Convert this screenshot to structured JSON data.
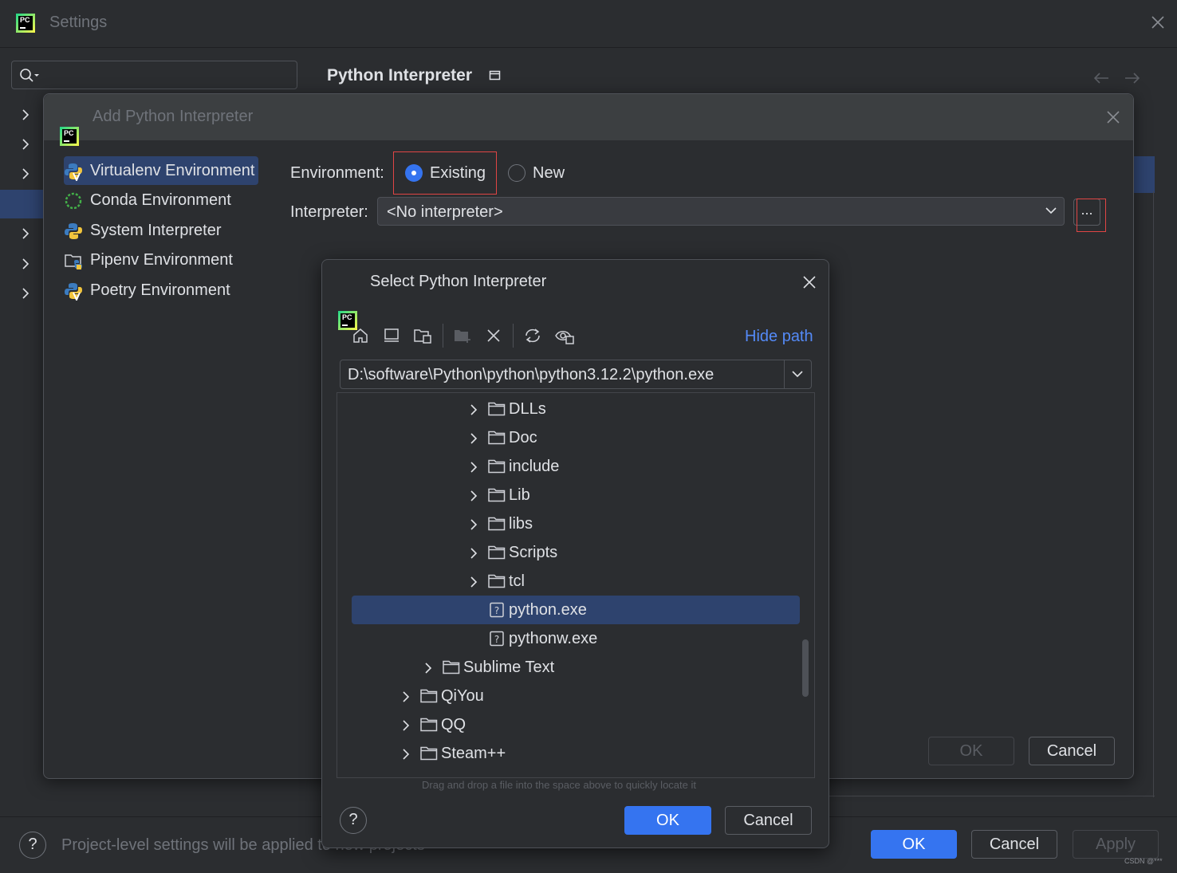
{
  "settings": {
    "title": "Settings",
    "heading": "Python Interpreter",
    "footer_note": "Project-level settings will be applied to new projects",
    "buttons": {
      "ok": "OK",
      "cancel": "Cancel",
      "apply": "Apply"
    },
    "help": "?"
  },
  "add_dialog": {
    "title": "Add Python Interpreter",
    "environments": [
      {
        "label": "Virtualenv Environment",
        "icon": "python-virtualenv-icon",
        "selected": true
      },
      {
        "label": "Conda Environment",
        "icon": "conda-icon",
        "selected": false
      },
      {
        "label": "System Interpreter",
        "icon": "python-icon",
        "selected": false
      },
      {
        "label": "Pipenv Environment",
        "icon": "pipenv-folder-icon",
        "selected": false
      },
      {
        "label": "Poetry Environment",
        "icon": "poetry-icon",
        "selected": false
      }
    ],
    "environment_label": "Environment:",
    "radio_existing": "Existing",
    "radio_new": "New",
    "interpreter_label": "Interpreter:",
    "interpreter_value": "<No interpreter>",
    "browse_label": "...",
    "buttons": {
      "ok": "OK",
      "cancel": "Cancel"
    }
  },
  "select_dialog": {
    "title": "Select Python Interpreter",
    "hide_path": "Hide path",
    "path": "D:\\software\\Python\\python\\python3.12.2\\python.exe",
    "toolbar_icons": [
      "home-icon",
      "desktop-icon",
      "project-folder-icon",
      "new-folder-icon",
      "delete-icon",
      "refresh-icon",
      "show-hidden-icon"
    ],
    "tree": [
      {
        "name": "DLLs",
        "type": "folder",
        "level": 3,
        "expandable": true,
        "selected": false
      },
      {
        "name": "Doc",
        "type": "folder",
        "level": 3,
        "expandable": true,
        "selected": false
      },
      {
        "name": "include",
        "type": "folder",
        "level": 3,
        "expandable": true,
        "selected": false
      },
      {
        "name": "Lib",
        "type": "folder",
        "level": 3,
        "expandable": true,
        "selected": false
      },
      {
        "name": "libs",
        "type": "folder",
        "level": 3,
        "expandable": true,
        "selected": false
      },
      {
        "name": "Scripts",
        "type": "folder",
        "level": 3,
        "expandable": true,
        "selected": false
      },
      {
        "name": "tcl",
        "type": "folder",
        "level": 3,
        "expandable": true,
        "selected": false
      },
      {
        "name": "python.exe",
        "type": "file",
        "level": 3,
        "expandable": false,
        "selected": true
      },
      {
        "name": "pythonw.exe",
        "type": "file",
        "level": 3,
        "expandable": false,
        "selected": false
      },
      {
        "name": "Sublime Text",
        "type": "folder",
        "level": 2,
        "expandable": true,
        "selected": false
      },
      {
        "name": "QiYou",
        "type": "folder",
        "level": 1,
        "expandable": true,
        "selected": false
      },
      {
        "name": "QQ",
        "type": "folder",
        "level": 1,
        "expandable": true,
        "selected": false
      },
      {
        "name": "Steam++",
        "type": "folder",
        "level": 1,
        "expandable": true,
        "selected": false
      }
    ],
    "drag_hint": "Drag and drop a file into the space above to quickly locate it",
    "buttons": {
      "ok": "OK",
      "cancel": "Cancel"
    },
    "help": "?"
  },
  "watermark": "CSDN @***",
  "colors": {
    "accent": "#3574f0",
    "selection": "#2e436e",
    "link": "#548af7",
    "highlight_box": "#e04545",
    "background": "#2b2d30"
  }
}
